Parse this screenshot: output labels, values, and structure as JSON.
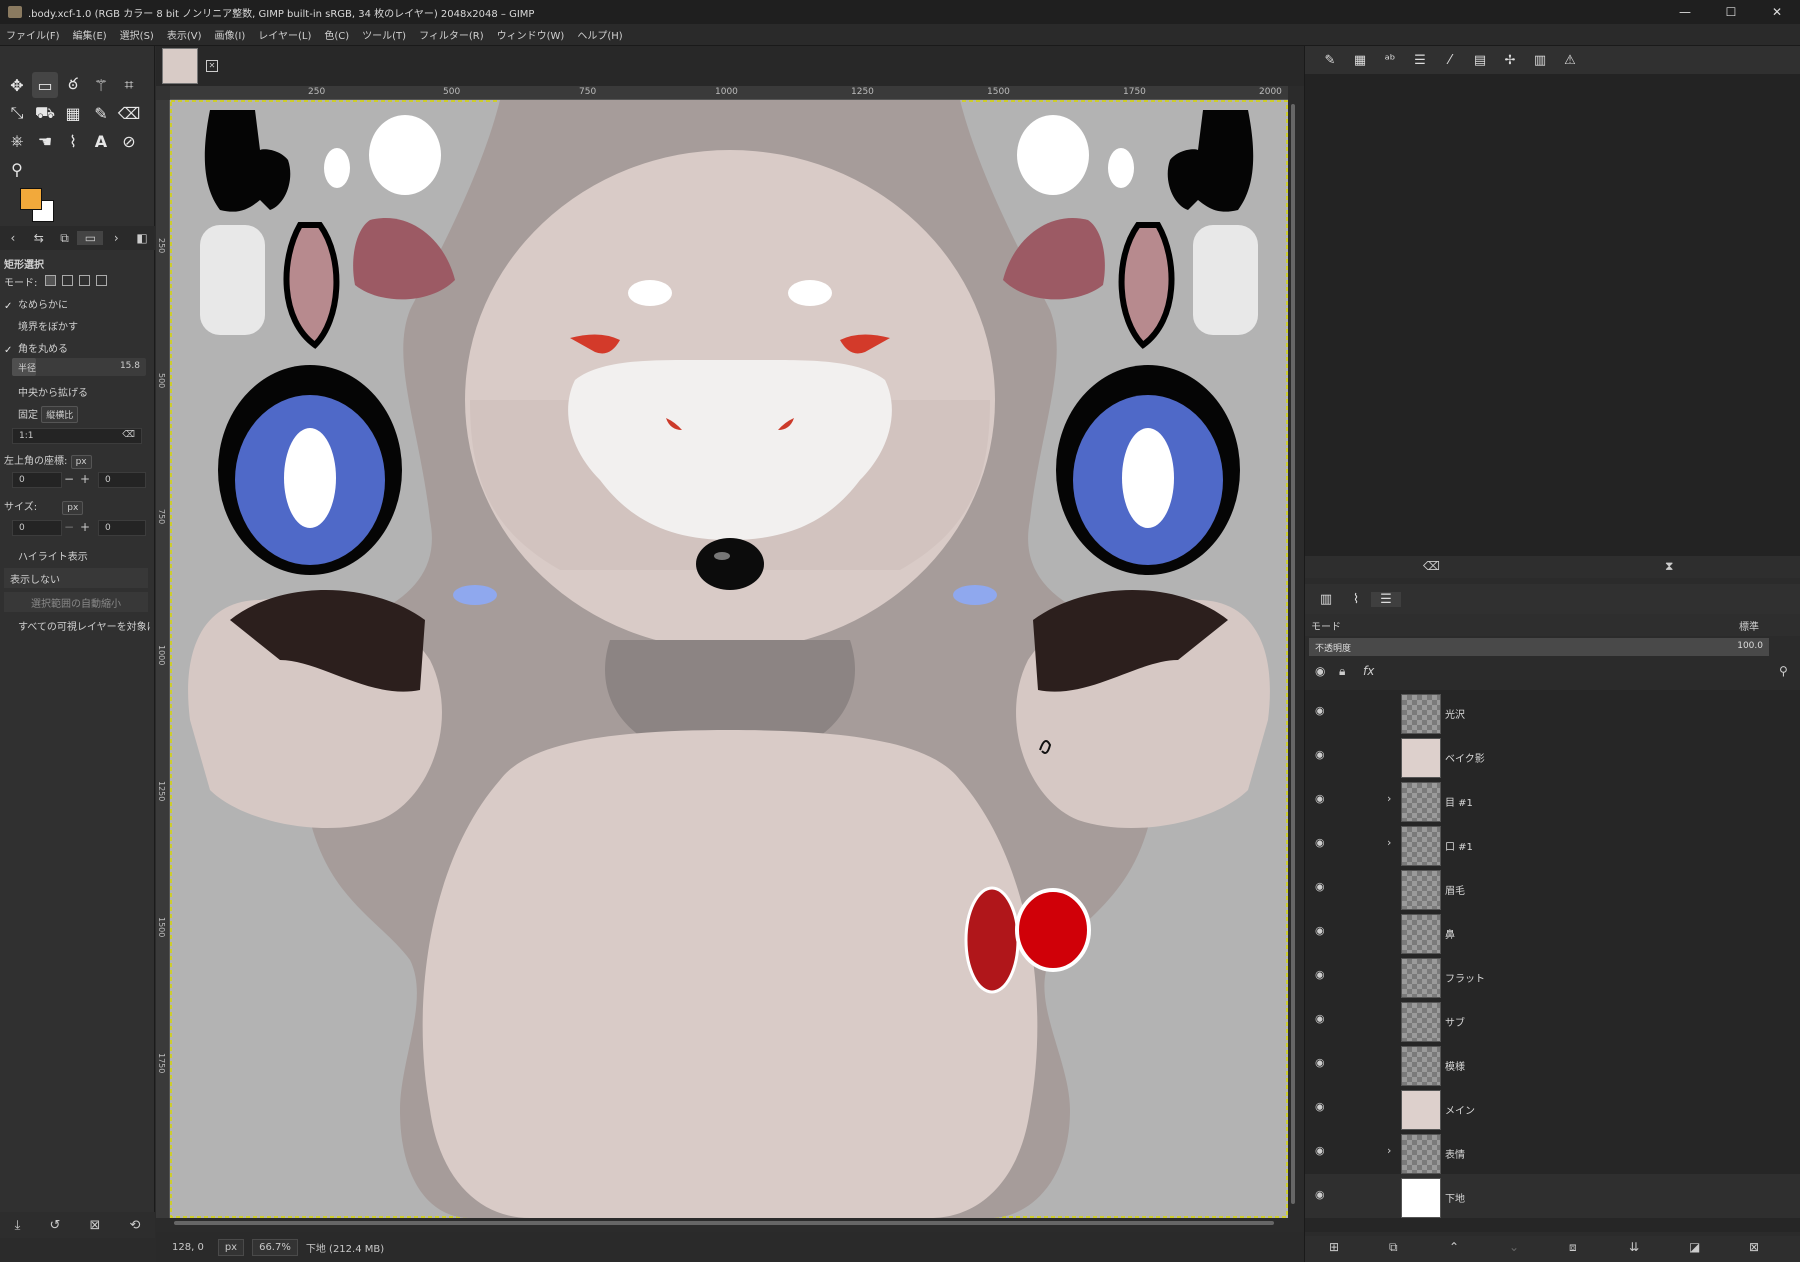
{
  "window": {
    "title": ".body.xcf-1.0 (RGB カラー 8 bit ノンリニア整数, GIMP built-in sRGB, 34 枚のレイヤー) 2048x2048 – GIMP",
    "minimize": "—",
    "maximize": "☐",
    "close": "✕"
  },
  "menu": [
    "ファイル(F)",
    "編集(E)",
    "選択(S)",
    "表示(V)",
    "画像(I)",
    "レイヤー(L)",
    "色(C)",
    "ツール(T)",
    "フィルター(R)",
    "ウィンドウ(W)",
    "ヘルプ(H)"
  ],
  "colors": {
    "fg": "#f2a93b",
    "bg": "#ffffff",
    "canvas_bg": "#b3b3b3"
  },
  "tool_options": {
    "title": "矩形選択",
    "mode_label": "モード:",
    "antialias": "なめらかに",
    "feather": "境界をぼかす",
    "round_corners": "角を丸める",
    "radius_label": "半径",
    "radius_value": "15.8",
    "expand_center": "中央から拡げる",
    "fixed": "固定",
    "fixed_mode": "縦横比",
    "ratio": "1:1",
    "position_label": "左上角の座標:",
    "position_unit": "px",
    "pos_x": "0",
    "pos_y": "0",
    "size_label": "サイズ:",
    "size_unit": "px",
    "size_w": "0",
    "size_h": "0",
    "highlight": "ハイライト表示",
    "guides": "表示しない",
    "auto_shrink": "選択範囲の自動縮小",
    "shrink_merged": "すべての可視レイヤーを対象にす"
  },
  "ruler_top": [
    "250",
    "500",
    "750",
    "1000",
    "1250",
    "1500",
    "1750",
    "2000"
  ],
  "ruler_left": [
    "250",
    "500",
    "750",
    "1000",
    "1250",
    "1500",
    "1750"
  ],
  "status": {
    "coords": "128, 0",
    "unit": "px",
    "zoom": "66.7%",
    "info": "下地 (212.4 MB)"
  },
  "layers_panel": {
    "mode_label": "モード",
    "mode_value": "標準",
    "opacity_label": "不透明度",
    "opacity_value": "100.0"
  },
  "layers": [
    {
      "name": "光沢",
      "group": false,
      "thumb": "checker"
    },
    {
      "name": "ベイク影",
      "group": false,
      "thumb": "face"
    },
    {
      "name": "目 #1",
      "group": true,
      "thumb": "checker"
    },
    {
      "name": "口 #1",
      "group": true,
      "thumb": "checker"
    },
    {
      "name": "眉毛",
      "group": false,
      "thumb": "checker"
    },
    {
      "name": "鼻",
      "group": false,
      "thumb": "checker"
    },
    {
      "name": "フラット",
      "group": false,
      "thumb": "checker"
    },
    {
      "name": "サブ",
      "group": false,
      "thumb": "checker"
    },
    {
      "name": "模様",
      "group": false,
      "thumb": "checker"
    },
    {
      "name": "メイン",
      "group": false,
      "thumb": "face"
    },
    {
      "name": "表情",
      "group": true,
      "thumb": "checker"
    },
    {
      "name": "下地",
      "group": false,
      "thumb": "white"
    }
  ]
}
